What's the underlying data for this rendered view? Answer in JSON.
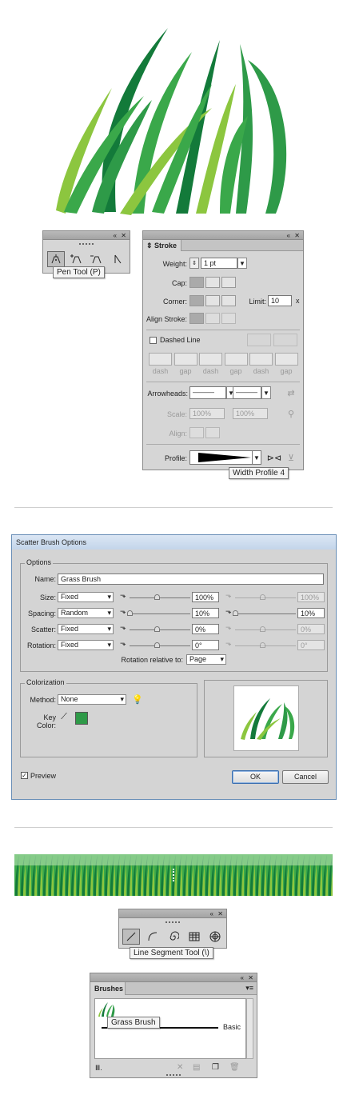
{
  "pen_toolbar": {
    "collapse_icon": "«",
    "close_icon": "✕",
    "tooltip": "Pen Tool (P)",
    "tools": [
      "pen-tool",
      "add-anchor-point-tool",
      "delete-anchor-point-tool",
      "convert-anchor-point-tool"
    ]
  },
  "stroke_panel": {
    "tab": "Stroke",
    "weight_label": "Weight:",
    "weight_value": "1 pt",
    "cap_label": "Cap:",
    "corner_label": "Corner:",
    "limit_label": "Limit:",
    "limit_value": "10",
    "limit_unit": "x",
    "align_label": "Align Stroke:",
    "dashed_label": "Dashed Line",
    "dash_labels": [
      "dash",
      "gap",
      "dash",
      "gap",
      "dash",
      "gap"
    ],
    "arrowheads_label": "Arrowheads:",
    "scale_label": "Scale:",
    "scale_start": "100%",
    "scale_end": "100%",
    "align_arrow_label": "Align:",
    "profile_label": "Profile:",
    "tooltip": "Width Profile 4"
  },
  "scatter_dialog": {
    "title": "Scatter Brush Options",
    "options_group": "Options",
    "name_label": "Name:",
    "name_value": "Grass Brush",
    "rows": [
      {
        "label": "Size:",
        "mode": "Fixed",
        "value1": "100%",
        "value2": "100%"
      },
      {
        "label": "Spacing:",
        "mode": "Random",
        "value1": "10%",
        "value2": "10%"
      },
      {
        "label": "Scatter:",
        "mode": "Fixed",
        "value1": "0%",
        "value2": "0%"
      },
      {
        "label": "Rotation:",
        "mode": "Fixed",
        "value1": "0°",
        "value2": "0°"
      }
    ],
    "rotation_relative_label": "Rotation relative to:",
    "rotation_relative_value": "Page",
    "colorization_group": "Colorization",
    "method_label": "Method:",
    "method_value": "None",
    "key_color_label": "Key Color:",
    "key_color": "#2e9a48",
    "preview_label": "Preview",
    "ok_label": "OK",
    "cancel_label": "Cancel"
  },
  "line_toolbar": {
    "tooltip": "Line Segment Tool (\\)",
    "tools": [
      "line-segment-tool",
      "arc-tool",
      "spiral-tool",
      "rectangular-grid-tool",
      "polar-grid-tool"
    ]
  },
  "brushes_panel": {
    "tab": "Brushes",
    "tooltip": "Grass Brush",
    "basic_label": "Basic"
  },
  "colors": {
    "grass_light": "#8cc63f",
    "grass_mid": "#3aa84a",
    "grass_dark": "#137a3a"
  }
}
